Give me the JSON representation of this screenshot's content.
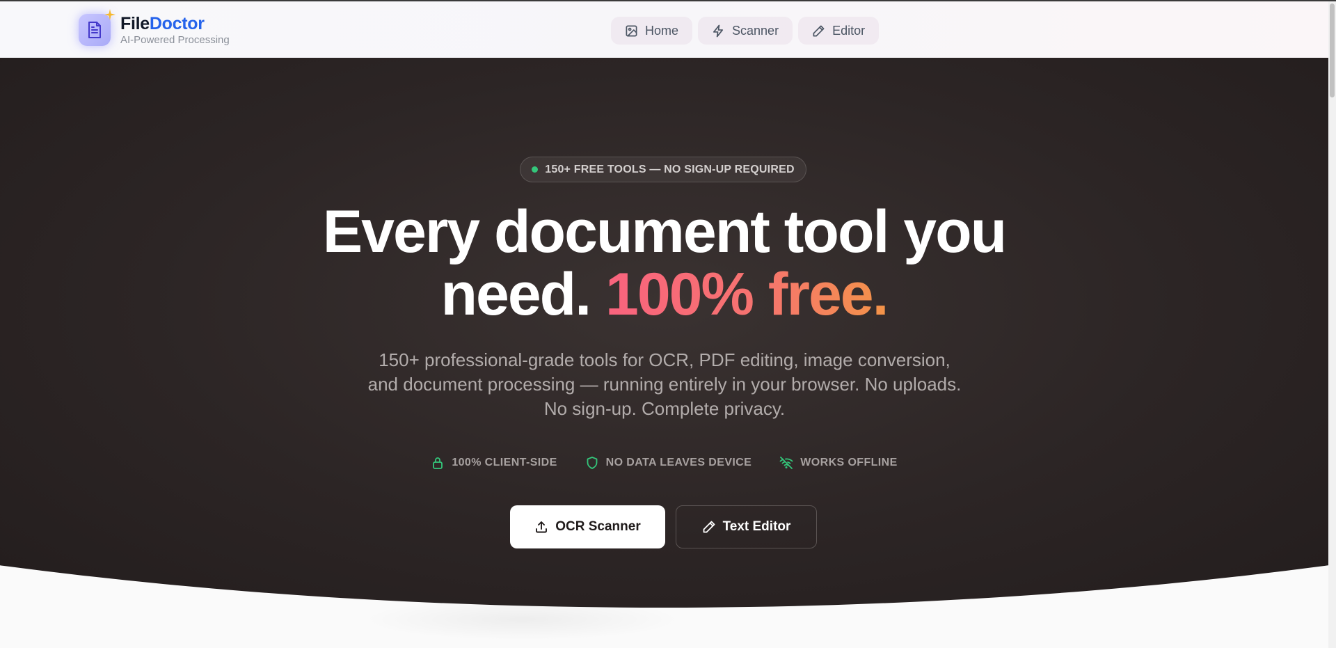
{
  "brand": {
    "name_part1": "File",
    "name_part2": "Doctor",
    "tagline": "AI-Powered Processing",
    "accent_color": "#2563eb"
  },
  "nav": {
    "items": [
      {
        "label": "Home",
        "icon": "image-icon"
      },
      {
        "label": "Scanner",
        "icon": "lightning-icon"
      },
      {
        "label": "Editor",
        "icon": "pencil-icon"
      }
    ]
  },
  "hero": {
    "badge": "150+ FREE TOOLS — NO SIGN-UP REQUIRED",
    "headline_line1": "Every document tool you",
    "headline_line2_plain": "need.",
    "headline_line2_gradient": "100% free.",
    "subtext": "150+ professional-grade tools for OCR, PDF editing, image conversion, and document processing — running entirely in your browser. No uploads. No sign-up. Complete privacy.",
    "features": [
      {
        "label": "100% CLIENT-SIDE",
        "icon": "lock-icon"
      },
      {
        "label": "NO DATA LEAVES DEVICE",
        "icon": "shield-icon"
      },
      {
        "label": "WORKS OFFLINE",
        "icon": "wifi-off-icon"
      }
    ],
    "primary_button": "OCR Scanner",
    "secondary_button": "Text Editor",
    "gradient_colors": [
      "#f9637e",
      "#f39448"
    ],
    "feature_icon_color": "#34c77b"
  }
}
